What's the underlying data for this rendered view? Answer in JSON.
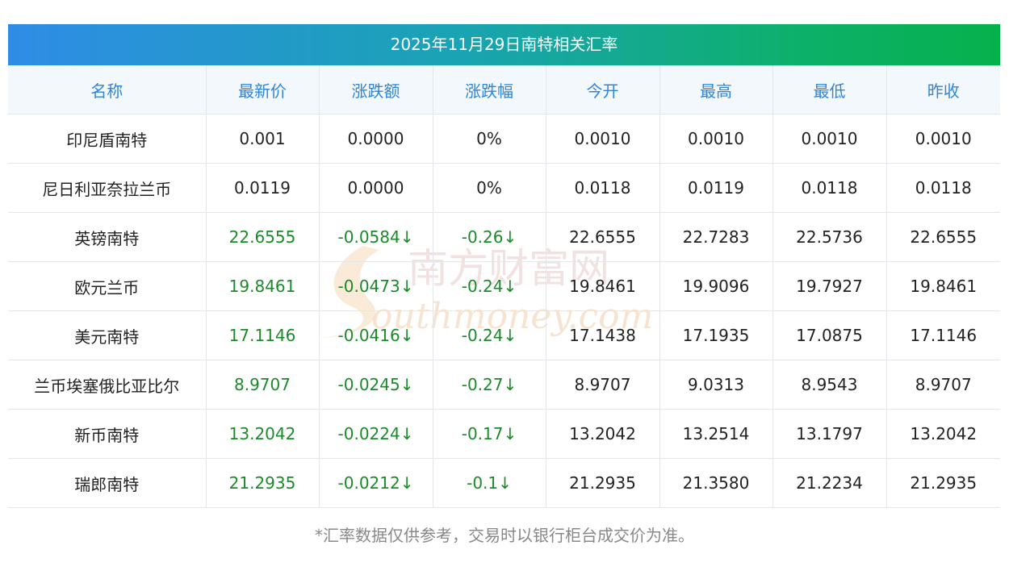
{
  "title": "2025年11月29日南特相关汇率",
  "headers": [
    "名称",
    "最新价",
    "涨跌额",
    "涨跌幅",
    "今开",
    "最高",
    "最低",
    "昨收"
  ],
  "rows": [
    {
      "name": "印尼盾南特",
      "latest": "0.001",
      "change": "0.0000",
      "pct": "0%",
      "open": "0.0010",
      "high": "0.0010",
      "low": "0.0010",
      "prev": "0.0010",
      "down": false
    },
    {
      "name": "尼日利亚奈拉兰币",
      "latest": "0.0119",
      "change": "0.0000",
      "pct": "0%",
      "open": "0.0118",
      "high": "0.0119",
      "low": "0.0118",
      "prev": "0.0118",
      "down": false
    },
    {
      "name": "英镑南特",
      "latest": "22.6555",
      "change": "-0.0584↓",
      "pct": "-0.26↓",
      "open": "22.6555",
      "high": "22.7283",
      "low": "22.5736",
      "prev": "22.6555",
      "down": true
    },
    {
      "name": "欧元兰币",
      "latest": "19.8461",
      "change": "-0.0473↓",
      "pct": "-0.24↓",
      "open": "19.8461",
      "high": "19.9096",
      "low": "19.7927",
      "prev": "19.8461",
      "down": true
    },
    {
      "name": "美元南特",
      "latest": "17.1146",
      "change": "-0.0416↓",
      "pct": "-0.24↓",
      "open": "17.1438",
      "high": "17.1935",
      "low": "17.0875",
      "prev": "17.1146",
      "down": true
    },
    {
      "name": "兰币埃塞俄比亚比尔",
      "latest": "8.9707",
      "change": "-0.0245↓",
      "pct": "-0.27↓",
      "open": "8.9707",
      "high": "9.0313",
      "low": "8.9543",
      "prev": "8.9707",
      "down": true
    },
    {
      "name": "新币南特",
      "latest": "13.2042",
      "change": "-0.0224↓",
      "pct": "-0.17↓",
      "open": "13.2042",
      "high": "13.2514",
      "low": "13.1797",
      "prev": "13.2042",
      "down": true
    },
    {
      "name": "瑞郎南特",
      "latest": "21.2935",
      "change": "-0.0212↓",
      "pct": "-0.1↓",
      "open": "21.2935",
      "high": "21.3580",
      "low": "21.2234",
      "prev": "21.2935",
      "down": true
    }
  ],
  "watermark": {
    "cn": "南方财富网",
    "en": "outhmoney.com"
  },
  "footer": "*汇率数据仅供参考，交易时以银行柜台成交价为准。",
  "colors": {
    "header_text": "#2f85d8",
    "up_green": "#1c8a2a",
    "gradient_start": "#2f8ce6",
    "gradient_end": "#06b14c"
  }
}
